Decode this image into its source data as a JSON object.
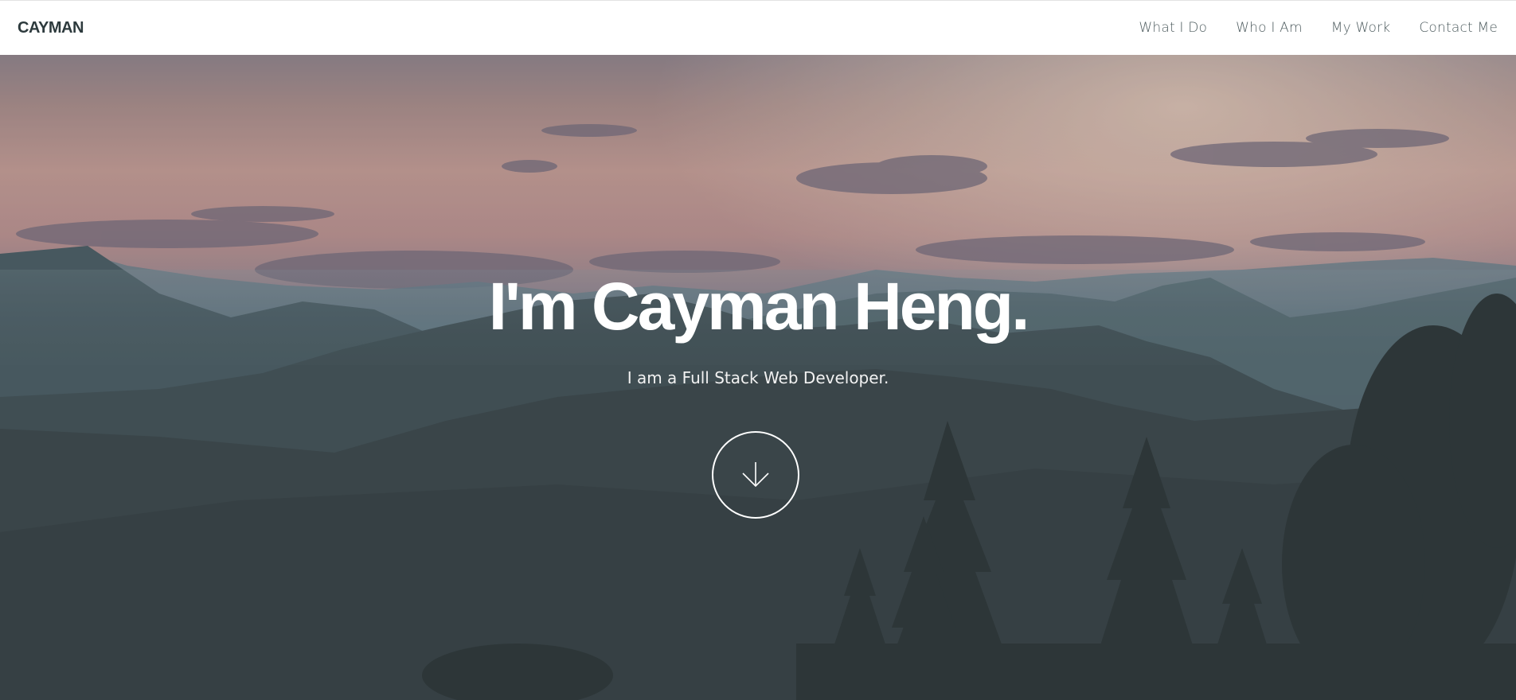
{
  "navbar": {
    "brand": "CAYMAN",
    "links": [
      {
        "label": "What I Do"
      },
      {
        "label": "Who I Am"
      },
      {
        "label": "My Work"
      },
      {
        "label": "Contact Me"
      }
    ]
  },
  "hero": {
    "title": "I'm Cayman Heng.",
    "subtitle": "I am a Full Stack Web Developer.",
    "scroll_icon": "arrow-down-icon"
  },
  "colors": {
    "navbar_bg": "#ffffff",
    "brand_text": "#2d3a3d",
    "nav_text": "#4d5b5e",
    "hero_text": "#ffffff"
  }
}
